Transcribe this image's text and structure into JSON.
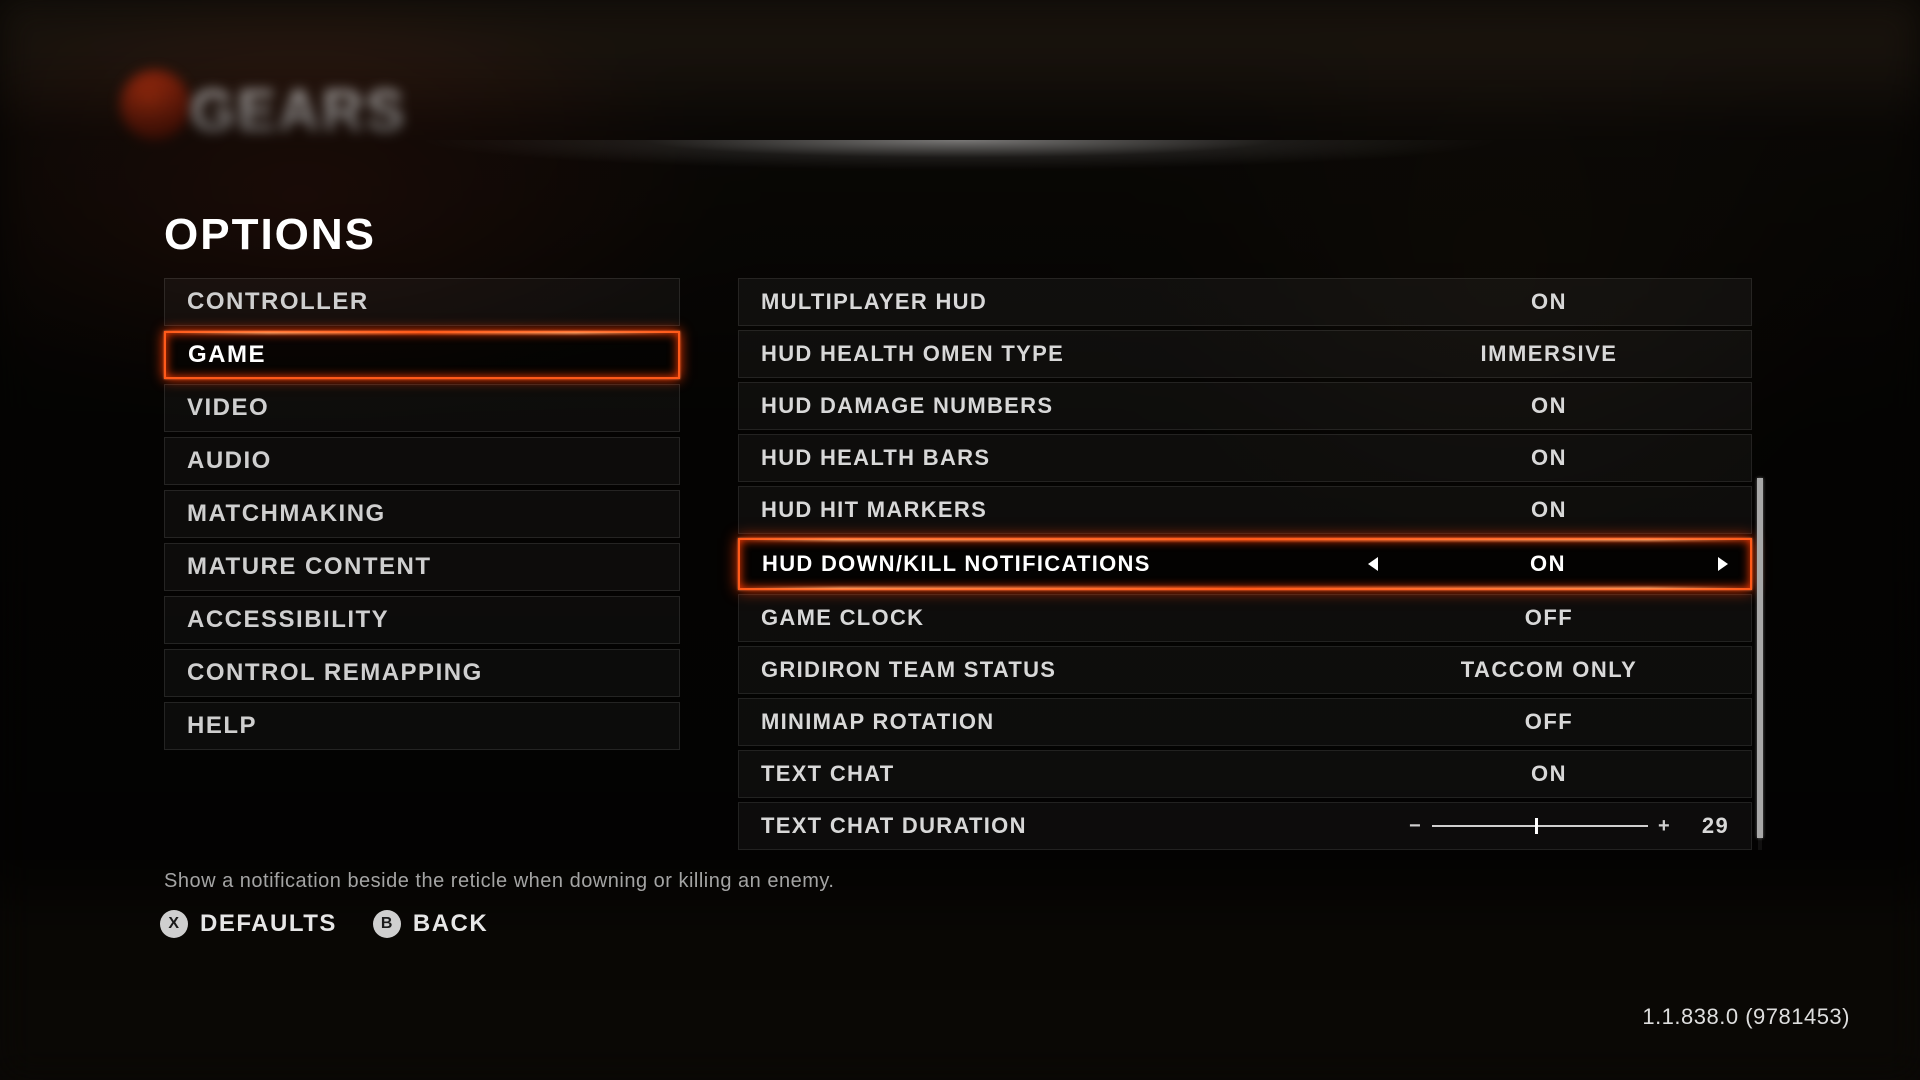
{
  "title": "OPTIONS",
  "sidebar": {
    "items": [
      {
        "label": "CONTROLLER"
      },
      {
        "label": "GAME"
      },
      {
        "label": "VIDEO"
      },
      {
        "label": "AUDIO"
      },
      {
        "label": "MATCHMAKING"
      },
      {
        "label": "MATURE CONTENT"
      },
      {
        "label": "ACCESSIBILITY"
      },
      {
        "label": "CONTROL REMAPPING"
      },
      {
        "label": "HELP"
      }
    ],
    "active_index": 1
  },
  "settings": [
    {
      "label": "MULTIPLAYER HUD",
      "value": "ON"
    },
    {
      "label": "HUD HEALTH OMEN TYPE",
      "value": "IMMERSIVE"
    },
    {
      "label": "HUD DAMAGE NUMBERS",
      "value": "ON"
    },
    {
      "label": "HUD HEALTH BARS",
      "value": "ON"
    },
    {
      "label": "HUD HIT MARKERS",
      "value": "ON"
    },
    {
      "label": "HUD DOWN/KILL NOTIFICATIONS",
      "value": "ON"
    },
    {
      "label": "GAME CLOCK",
      "value": "OFF"
    },
    {
      "label": "GRIDIRON TEAM STATUS",
      "value": "TACCOM ONLY"
    },
    {
      "label": "MINIMAP ROTATION",
      "value": "OFF"
    },
    {
      "label": "TEXT CHAT",
      "value": "ON"
    },
    {
      "label": "TEXT CHAT DURATION",
      "type": "slider",
      "value": "29",
      "min": 0,
      "max": 60
    }
  ],
  "highlight_index": 5,
  "description": "Show a notification beside the reticle when downing or killing an enemy.",
  "footer": {
    "defaults_key": "X",
    "defaults_label": "DEFAULTS",
    "back_key": "B",
    "back_label": "BACK"
  },
  "version": "1.1.838.0 (9781453)",
  "logo_text": "GEARS",
  "colors": {
    "accent": "#ff5a1a",
    "accent_glow": "#ff3b00"
  }
}
